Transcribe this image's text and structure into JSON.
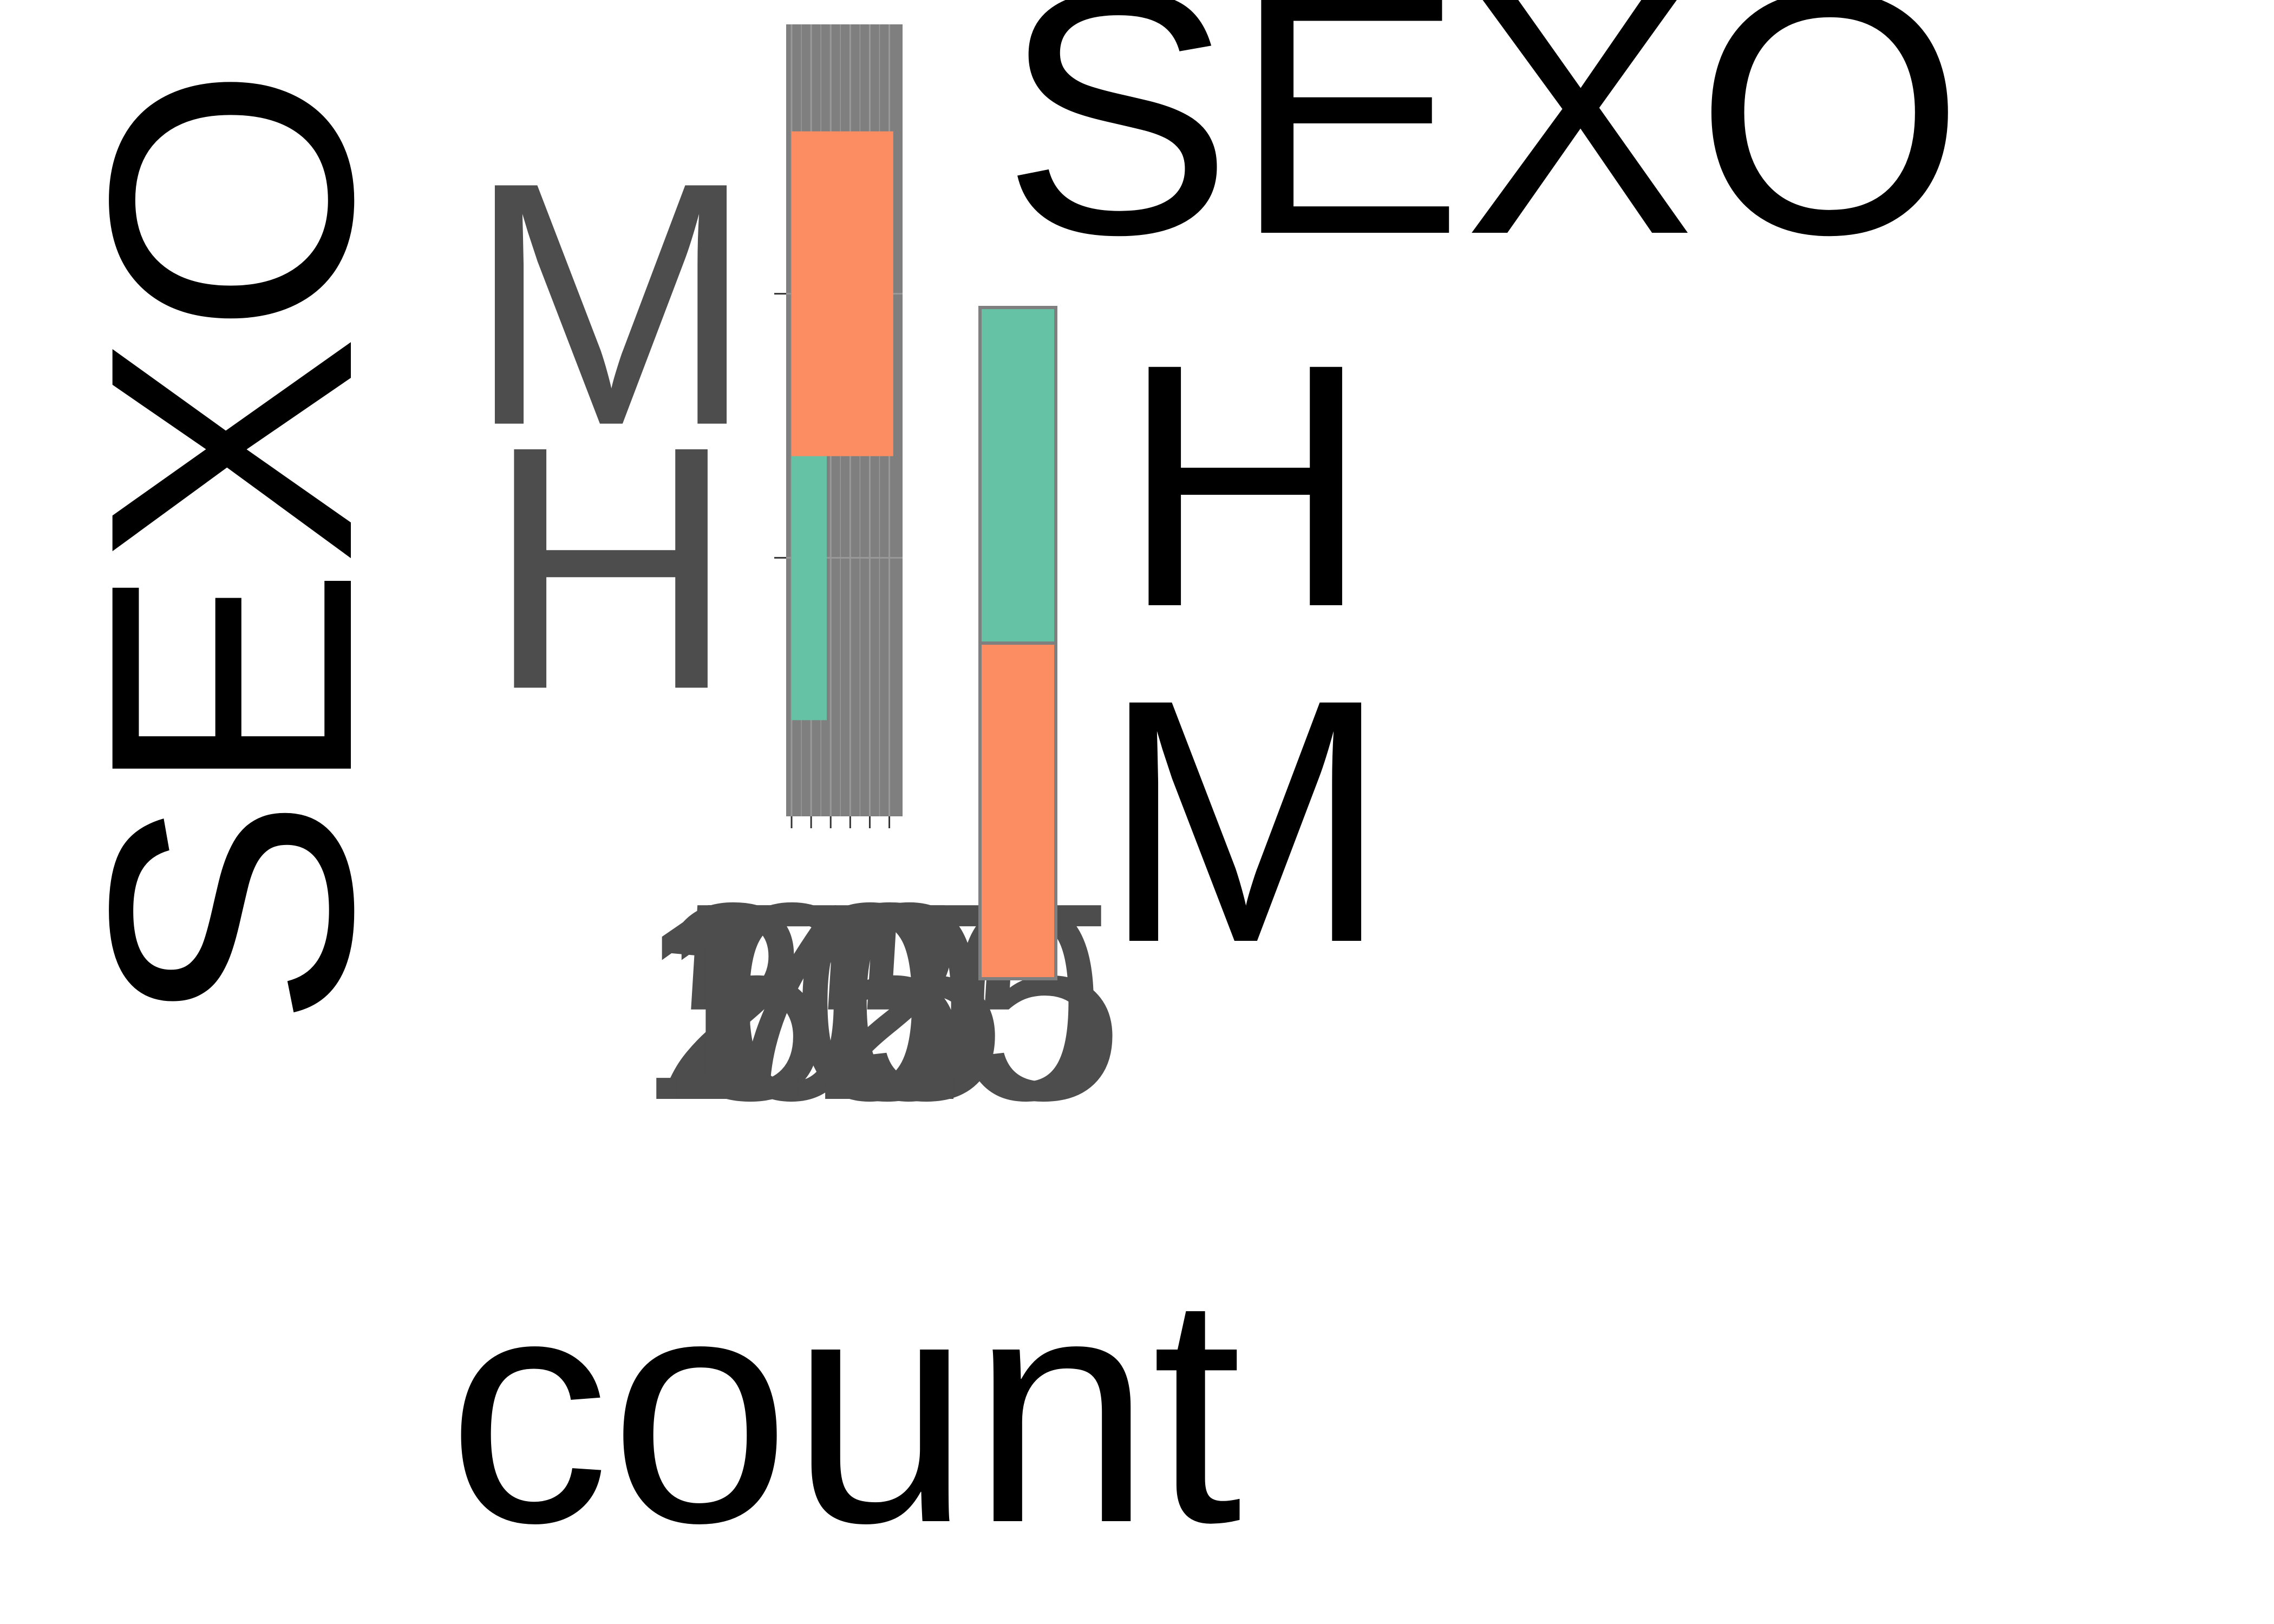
{
  "chart_data": {
    "type": "bar",
    "orientation": "horizontal",
    "categories": [
      "H",
      "M"
    ],
    "values": [
      45,
      130
    ],
    "xlabel": "count",
    "ylabel": "SEXO",
    "xlim": [
      0,
      135
    ],
    "x_ticks": [
      0,
      25,
      50,
      75,
      100,
      125
    ],
    "x_tick_labels": [
      "0",
      "25",
      "50",
      "75",
      "100",
      "125"
    ],
    "grid": true,
    "panel_background": "#7f7f7f",
    "series_colors": {
      "H": "#66c2a5",
      "M": "#fc8d62"
    },
    "legend": {
      "title": "SEXO",
      "position": "right",
      "items": [
        {
          "label": "H",
          "color": "#66c2a5"
        },
        {
          "label": "M",
          "color": "#fc8d62"
        }
      ]
    }
  }
}
